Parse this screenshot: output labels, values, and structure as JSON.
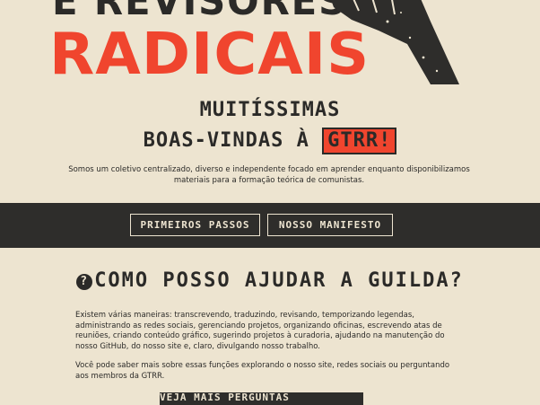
{
  "hero": {
    "line1": "E REVISORES",
    "line2": "RADICAIS",
    "welcome_line1": "MUITÍSSIMAS",
    "welcome_line2_prefix": "BOAS-VINDAS À ",
    "welcome_highlight": "GTRR!",
    "intro": "Somos um coletivo centralizado, diverso e independente focado em aprender enquanto disponibilizamos materiais para a formação teórica de comunistas."
  },
  "nav": {
    "first_steps": "PRIMEIROS PASSOS",
    "manifesto": "NOSSO MANIFESTO"
  },
  "help": {
    "icon_glyph": "?",
    "title": "COMO POSSO AJUDAR A GUILDA?",
    "paragraph1": "Existem várias maneiras: transcrevendo, traduzindo, revisando, temporizando legendas, administrando as redes sociais, gerenciando projetos, organizando oficinas, escrevendo atas de reuniões, criando conteúdo gráfico, sugerindo projetos à curadoria, ajudando na manutenção do nosso GitHub, do nosso site e, claro, divulgando nosso trabalho.",
    "paragraph2": "Você pode saber mais sobre essas funções explorando o nosso site, redes sociais ou perguntando aos membros da GTRR.",
    "faq_button": "VEJA MAIS PERGUNTAS FREQUENTES"
  },
  "colors": {
    "background": "#ede4d0",
    "accent_red": "#f0452e",
    "dark": "#2e2d2b"
  }
}
